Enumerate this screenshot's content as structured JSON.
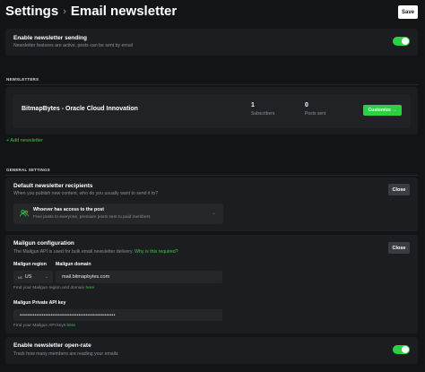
{
  "header": {
    "breadcrumb_parent": "Settings",
    "breadcrumb_current": "Email newsletter",
    "save_label": "Save"
  },
  "enable_sending": {
    "title": "Enable newsletter sending",
    "description": "Newsletter features are active, posts can be sent by email",
    "enabled": true
  },
  "newsletters": {
    "section_label": "NEWSLETTERS",
    "items": [
      {
        "name": "BitmapBytes - Oracle Cloud Innovation",
        "subscribers_count": "1",
        "subscribers_label": "Subscribers",
        "posts_count": "0",
        "posts_label": "Posts sent",
        "customize_label": "Customize →"
      }
    ],
    "add_label": "+ Add newsletter"
  },
  "general": {
    "section_label": "GENERAL SETTINGS",
    "recipients": {
      "title": "Default newsletter recipients",
      "description": "When you publish new content, who do you usually want to send it to?",
      "close_label": "Close",
      "option_title": "Whoever has access to the post",
      "option_description": "Free posts to everyone, premium posts sent to paid members"
    },
    "mailgun": {
      "title": "Mailgun configuration",
      "description_prefix": "The Mailgun API is used for bulk email newsletter delivery.",
      "description_link": "Why is this required?",
      "close_label": "Close",
      "region_label": "Mailgun region",
      "region_value": "US",
      "domain_label": "Mailgun domain",
      "domain_value": "mail.bitmapbytes.com",
      "region_hint_prefix": "Find your Mailgun region and domain",
      "region_hint_link": "here",
      "api_key_label": "Mailgun Private API key",
      "api_key_value": "••••••••••••••••••••••••••••••••••••••••••••••••••••",
      "api_hint_prefix": "Find your Mailgun API keys",
      "api_hint_link": "here"
    },
    "open_rate": {
      "title": "Enable newsletter open-rate",
      "description": "Track how many members are reading your emails",
      "enabled": true
    }
  },
  "colors": {
    "accent": "#30cf43",
    "background": "#131416",
    "card": "#1c1d21"
  }
}
